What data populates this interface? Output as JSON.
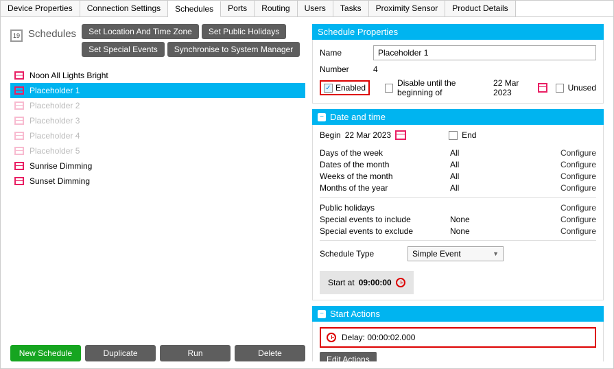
{
  "tabs": [
    "Device Properties",
    "Connection Settings",
    "Schedules",
    "Ports",
    "Routing",
    "Users",
    "Tasks",
    "Proximity Sensor",
    "Product Details"
  ],
  "activeTab": 2,
  "left": {
    "calendarBadge": "19",
    "title": "Schedules",
    "buttons": [
      "Set Location And Time Zone",
      "Set Public Holidays",
      "Set Special Events",
      "Synchronise to System Manager"
    ],
    "schedules": [
      {
        "label": "Noon All Lights Bright",
        "selected": false,
        "dim": false
      },
      {
        "label": "Placeholder 1",
        "selected": true,
        "dim": false
      },
      {
        "label": "Placeholder 2",
        "selected": false,
        "dim": true
      },
      {
        "label": "Placeholder 3",
        "selected": false,
        "dim": true
      },
      {
        "label": "Placeholder 4",
        "selected": false,
        "dim": true
      },
      {
        "label": "Placeholder 5",
        "selected": false,
        "dim": true
      },
      {
        "label": "Sunrise Dimming",
        "selected": false,
        "dim": false
      },
      {
        "label": "Sunset Dimming",
        "selected": false,
        "dim": false
      }
    ],
    "bottomButtons": {
      "new": "New Schedule",
      "duplicate": "Duplicate",
      "run": "Run",
      "delete": "Delete"
    }
  },
  "properties": {
    "header": "Schedule Properties",
    "nameLabel": "Name",
    "nameValue": "Placeholder 1",
    "numberLabel": "Number",
    "numberValue": "4",
    "enabledLabel": "Enabled",
    "disableUntilLabel": "Disable until the beginning of",
    "disableUntilDate": "22 Mar 2023",
    "unusedLabel": "Unused"
  },
  "datetime": {
    "header": "Date and time",
    "beginLabel": "Begin",
    "beginDate": "22 Mar 2023",
    "endLabel": "End",
    "rows": [
      {
        "label": "Days of the week",
        "value": "All",
        "action": "Configure"
      },
      {
        "label": "Dates of the month",
        "value": "All",
        "action": "Configure"
      },
      {
        "label": "Weeks of the month",
        "value": "All",
        "action": "Configure"
      },
      {
        "label": "Months of the year",
        "value": "All",
        "action": "Configure"
      }
    ],
    "extraRows": [
      {
        "label": "Public holidays",
        "value": "",
        "action": "Configure"
      },
      {
        "label": "Special events to include",
        "value": "None",
        "action": "Configure"
      },
      {
        "label": "Special events to exclude",
        "value": "None",
        "action": "Configure"
      }
    ],
    "scheduleTypeLabel": "Schedule Type",
    "scheduleTypeValue": "Simple Event",
    "startAtLabel": "Start at",
    "startAtTime": "09:00:00"
  },
  "startActions": {
    "header": "Start Actions",
    "delayLabel": "Delay: 00:00:02.000",
    "editLabel": "Edit Actions"
  }
}
